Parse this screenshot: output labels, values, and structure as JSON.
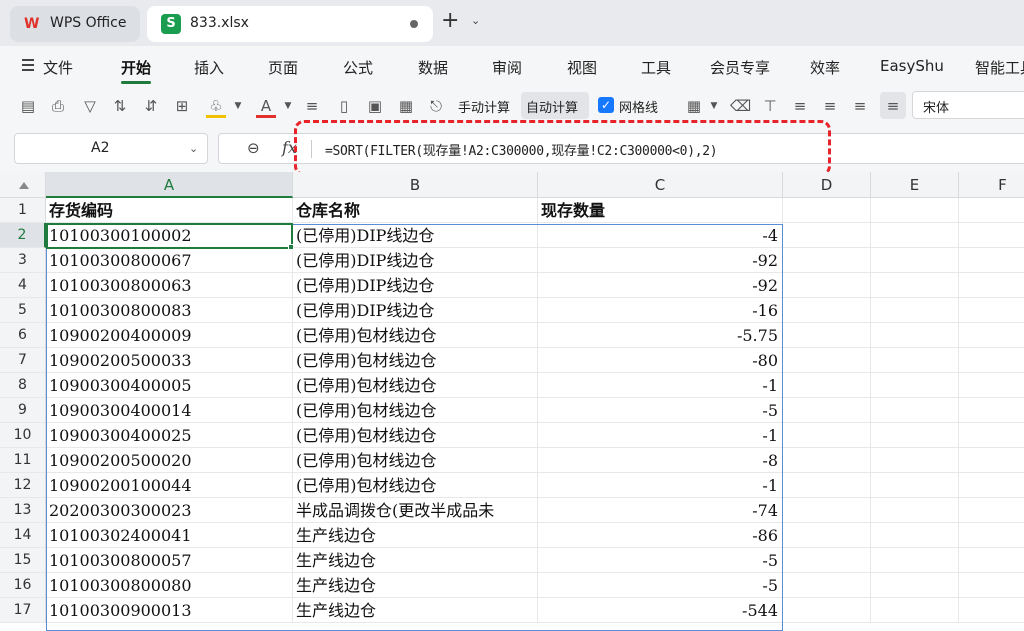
{
  "titlebar": {
    "app_tab_label": "WPS Office",
    "file_tab_label": "833.xlsx",
    "file_icon_letter": "S",
    "new_tab_glyph": "+"
  },
  "menu": {
    "file_label": "文件",
    "items": [
      "开始",
      "插入",
      "页面",
      "公式",
      "数据",
      "审阅",
      "视图",
      "工具",
      "会员专享",
      "效率",
      "EasyShu",
      "智能工具"
    ],
    "active_index": 0
  },
  "toolbar": {
    "manual_calc_label": "手动计算",
    "auto_calc_label": "自动计算",
    "gridlines_label": "网格线",
    "gridlines_checked": true,
    "font_name": "宋体",
    "accent_color": "#1f7a3e",
    "font_color_bar": "#e0322b",
    "fill_color_bar": "#f2c200"
  },
  "formula_bar": {
    "cell_ref": "A2",
    "formula": "=SORT(FILTER(现存量!A2:C300000,现存量!C2:C300000<0),2)",
    "highlight_color": "#e8232a"
  },
  "grid": {
    "columns": [
      "A",
      "B",
      "C",
      "D",
      "E",
      "F"
    ],
    "active_column": "A",
    "active_row": 2,
    "header_row": {
      "row": 1,
      "a": "存货编码",
      "b": "仓库名称",
      "c": "现存数量"
    },
    "rows": [
      {
        "row": 2,
        "a": "10100300100002",
        "b": "(已停用)DIP线边仓",
        "c": "-4"
      },
      {
        "row": 3,
        "a": "10100300800067",
        "b": "(已停用)DIP线边仓",
        "c": "-92"
      },
      {
        "row": 4,
        "a": "10100300800063",
        "b": "(已停用)DIP线边仓",
        "c": "-92"
      },
      {
        "row": 5,
        "a": "10100300800083",
        "b": "(已停用)DIP线边仓",
        "c": "-16"
      },
      {
        "row": 6,
        "a": "10900200400009",
        "b": "(已停用)包材线边仓",
        "c": "-5.75"
      },
      {
        "row": 7,
        "a": "10900200500033",
        "b": "(已停用)包材线边仓",
        "c": "-80"
      },
      {
        "row": 8,
        "a": "10900300400005",
        "b": "(已停用)包材线边仓",
        "c": "-1"
      },
      {
        "row": 9,
        "a": "10900300400014",
        "b": "(已停用)包材线边仓",
        "c": "-5"
      },
      {
        "row": 10,
        "a": "10900300400025",
        "b": "(已停用)包材线边仓",
        "c": "-1"
      },
      {
        "row": 11,
        "a": "10900200500020",
        "b": "(已停用)包材线边仓",
        "c": "-8"
      },
      {
        "row": 12,
        "a": "10900200100044",
        "b": "(已停用)包材线边仓",
        "c": "-1"
      },
      {
        "row": 13,
        "a": "20200300300023",
        "b": "半成品调拨仓(更改半成品未",
        "c": "-74"
      },
      {
        "row": 14,
        "a": "10100302400041",
        "b": "生产线边仓",
        "c": "-86"
      },
      {
        "row": 15,
        "a": "10100300800057",
        "b": "生产线边仓",
        "c": "-5"
      },
      {
        "row": 16,
        "a": "10100300800080",
        "b": "生产线边仓",
        "c": "-5"
      },
      {
        "row": 17,
        "a": "10100300900013",
        "b": "生产线边仓",
        "c": "-544"
      }
    ]
  }
}
